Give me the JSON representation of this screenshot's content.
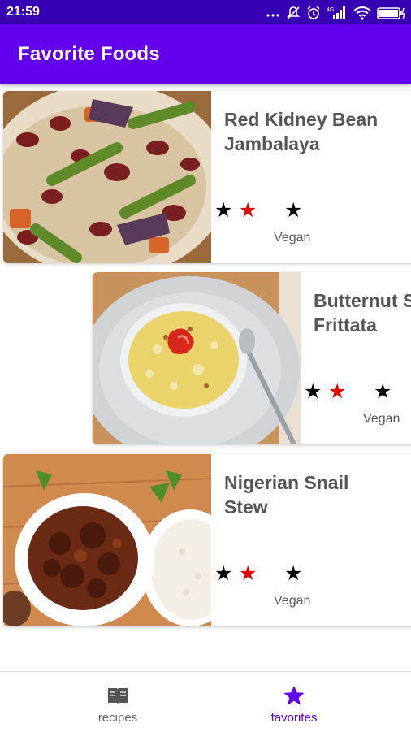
{
  "status_bar": {
    "time": "21:59",
    "icons": [
      "more-dots-icon",
      "mute-icon",
      "alarm-icon",
      "cellular-signal-icon",
      "wifi-icon",
      "battery-icon"
    ],
    "network_label": "4G"
  },
  "app_bar": {
    "title": "Favorite Foods",
    "color": "#6200ee",
    "status_color": "#3700b3"
  },
  "recipes": [
    {
      "name": "Red Kidney Bean\nJambalaya",
      "badge": "Vegan",
      "rating_colors": [
        "#000000",
        "#e00000",
        "#000000"
      ]
    },
    {
      "name": "Butternut Squash\nFrittata",
      "badge": "Vegan",
      "rating_colors": [
        "#000000",
        "#e00000",
        "#000000"
      ]
    },
    {
      "name": "Nigerian Snail\nStew",
      "badge": "Vegan",
      "rating_colors": [
        "#000000",
        "#e00000",
        "#000000"
      ]
    }
  ],
  "bottom_nav": {
    "items": [
      {
        "label": "recipes",
        "icon": "book-icon",
        "selected": false
      },
      {
        "label": "favorites",
        "icon": "star-icon",
        "selected": true
      }
    ],
    "active_color": "#6200ee",
    "inactive_color": "#666666"
  }
}
